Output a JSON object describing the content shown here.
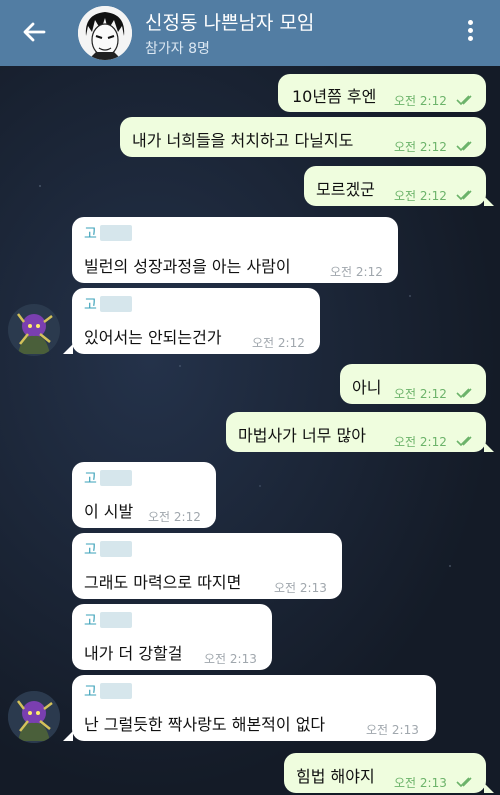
{
  "header": {
    "title": "신정동 나쁜남자 모임",
    "subtitle": "참가자 8명"
  },
  "messages": [
    {
      "dir": "out",
      "text": "10년쯤 후엔",
      "time": "오전 2:12"
    },
    {
      "dir": "out",
      "text": "내가 너희들을 처치하고 다닐지도",
      "time": "오전 2:12"
    },
    {
      "dir": "out",
      "text": "모르겠군",
      "time": "오전 2:12"
    },
    {
      "dir": "in",
      "sender": "고",
      "text": "빌런의 성장과정을 아는 사람이",
      "time": "오전 2:12"
    },
    {
      "dir": "in",
      "sender": "고",
      "text": "있어서는 안되는건가",
      "time": "오전 2:12"
    },
    {
      "dir": "out",
      "text": "아니",
      "time": "오전 2:12"
    },
    {
      "dir": "out",
      "text": "마법사가 너무 많아",
      "time": "오전 2:12"
    },
    {
      "dir": "in",
      "sender": "고",
      "text": "이 시발",
      "time": "오전 2:12"
    },
    {
      "dir": "in",
      "sender": "고",
      "text": "그래도 마력으로 따지면",
      "time": "오전 2:13"
    },
    {
      "dir": "in",
      "sender": "고",
      "text": "내가 더 강할걸",
      "time": "오전 2:13"
    },
    {
      "dir": "in",
      "sender": "고",
      "text": "난 그럴듯한 짝사랑도 해본적이 없다",
      "time": "오전 2:13"
    },
    {
      "dir": "out",
      "text": "힘법 해야지",
      "time": "오전 2:13"
    }
  ],
  "colors": {
    "header": "#527da3",
    "outgoing_bubble": "#effdde",
    "incoming_bubble": "#ffffff",
    "sender_name": "#3aa0b8",
    "read_checks": "#6cb36a"
  },
  "icons": {
    "back": "arrow-left-icon",
    "menu": "more-vertical-icon",
    "read": "double-check-icon"
  }
}
